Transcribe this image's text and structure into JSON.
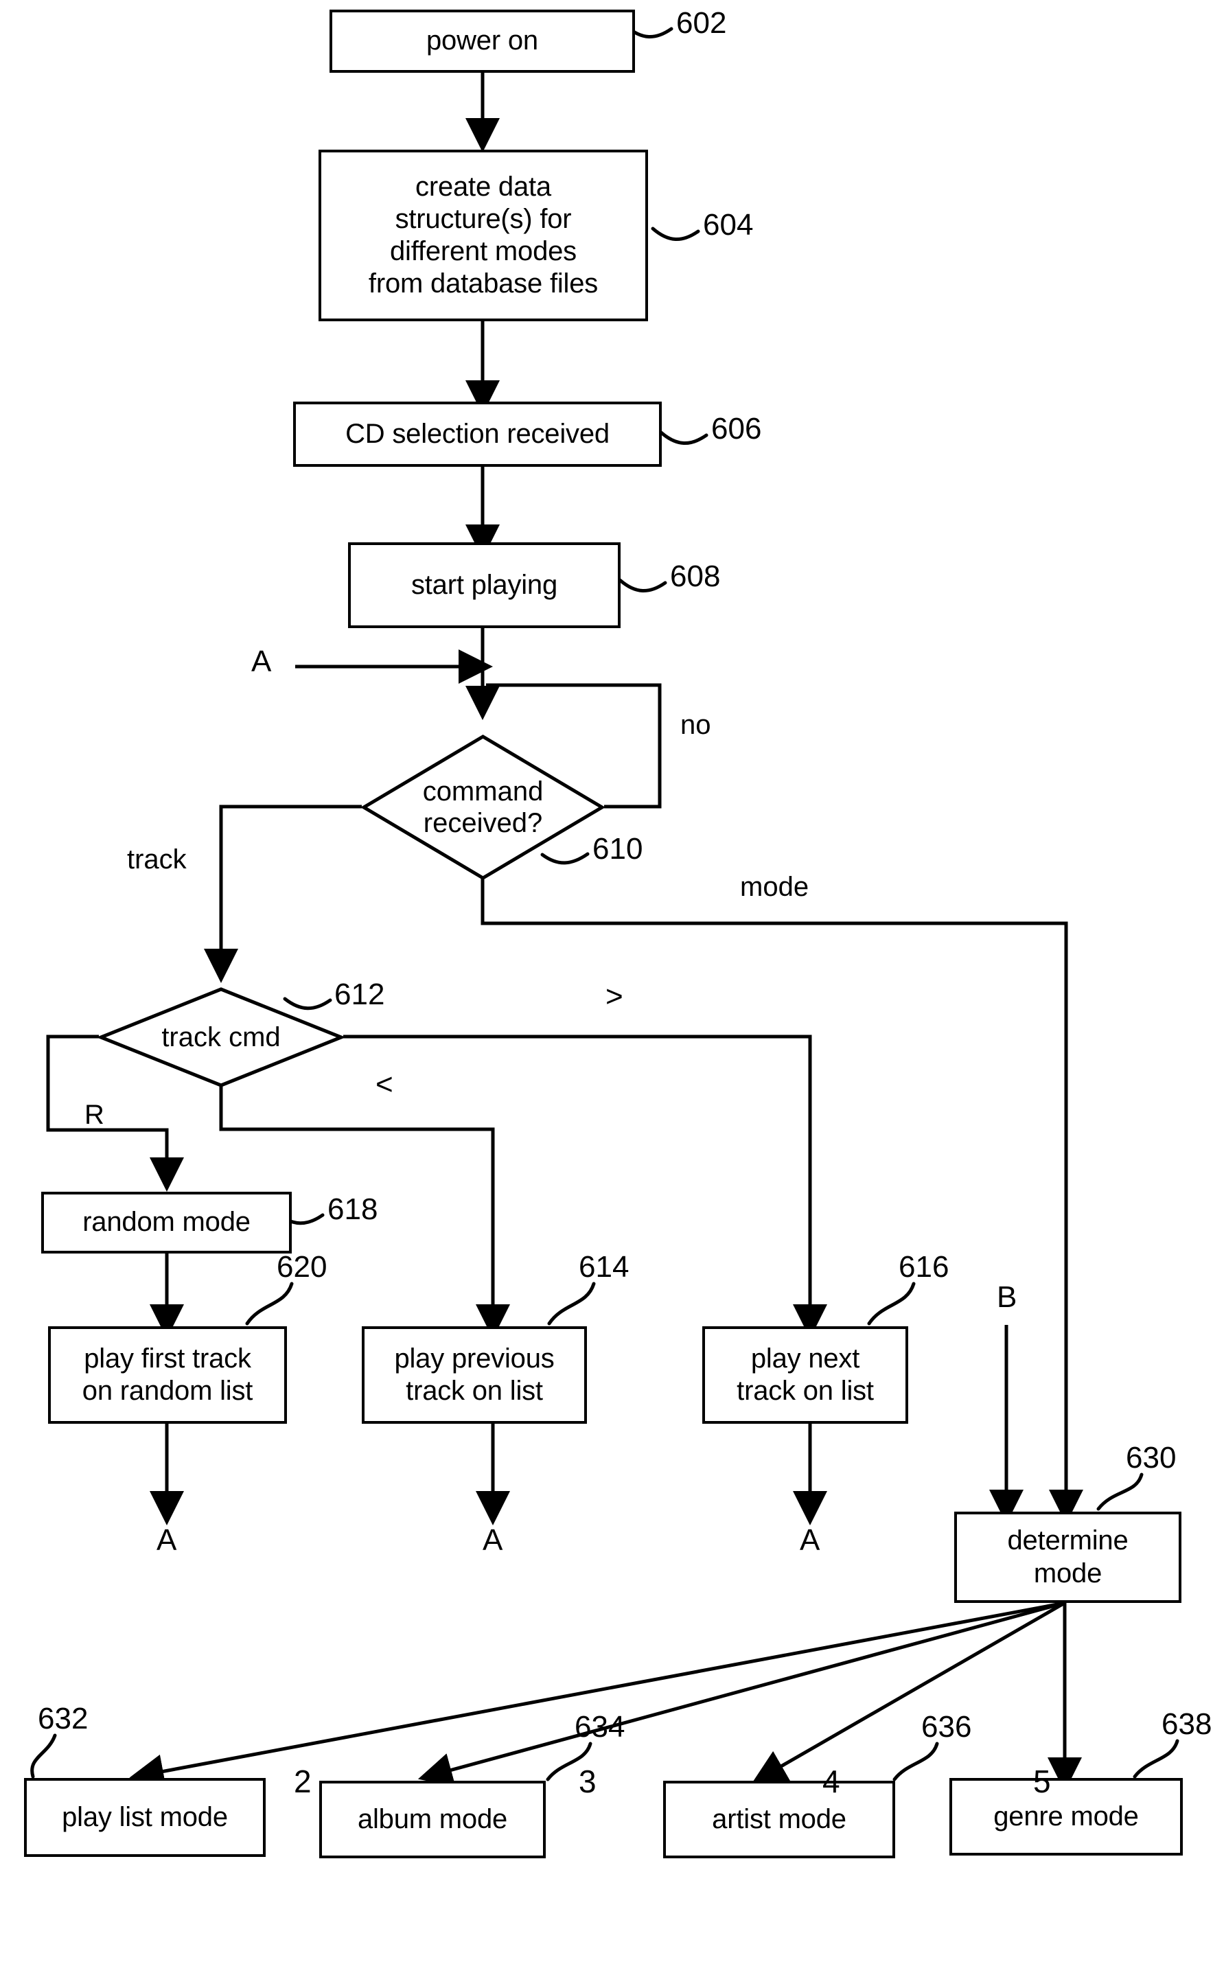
{
  "figure": {
    "type": "flowchart",
    "title": "CD player mode-selection flowchart",
    "stroke_color": "#000000",
    "background_color": "#ffffff"
  },
  "nodes": {
    "power_on": {
      "label": "power on",
      "ref": "602",
      "shape": "rect"
    },
    "create_data": {
      "label": "create data structure(s) for different modes from database files",
      "line1": "create data",
      "line2": "structure(s) for",
      "line3": "different modes",
      "line4": "from database files",
      "ref": "604",
      "shape": "rect"
    },
    "cd_selection": {
      "label": "CD selection received",
      "ref": "606",
      "shape": "rect"
    },
    "start_playing": {
      "label": "start playing",
      "ref": "608",
      "shape": "rect"
    },
    "command_received": {
      "line1": "command",
      "line2": "received?",
      "ref": "610",
      "shape": "diamond"
    },
    "track_cmd": {
      "label": "track cmd",
      "ref": "612",
      "shape": "diamond"
    },
    "random_mode": {
      "label": "random mode",
      "ref": "618",
      "shape": "rect"
    },
    "play_first_random": {
      "line1": "play first track",
      "line2": "on random list",
      "ref": "620",
      "shape": "rect"
    },
    "play_previous": {
      "line1": "play previous",
      "line2": "track on list",
      "ref": "614",
      "shape": "rect"
    },
    "play_next": {
      "line1": "play next",
      "line2": "track on list",
      "ref": "616",
      "shape": "rect"
    },
    "determine_mode": {
      "line1": "determine",
      "line2": "mode",
      "ref": "630",
      "shape": "rect"
    },
    "play_list_mode": {
      "label": "play list mode",
      "ref": "632",
      "shape": "rect"
    },
    "album_mode": {
      "label": "album mode",
      "ref": "634",
      "shape": "rect"
    },
    "artist_mode": {
      "label": "artist mode",
      "ref": "636",
      "shape": "rect"
    },
    "genre_mode": {
      "label": "genre mode",
      "ref": "638",
      "shape": "rect"
    }
  },
  "edge_labels": {
    "no": "no",
    "track": "track",
    "mode": "mode",
    "random": "R",
    "greater_than": ">",
    "less_than": "<",
    "branch_2": "2",
    "branch_3": "3",
    "branch_4": "4",
    "branch_5": "5"
  },
  "connectors": {
    "a_entry": "A",
    "a_exit_1": "A",
    "a_exit_2": "A",
    "a_exit_3": "A",
    "b_entry": "B"
  }
}
